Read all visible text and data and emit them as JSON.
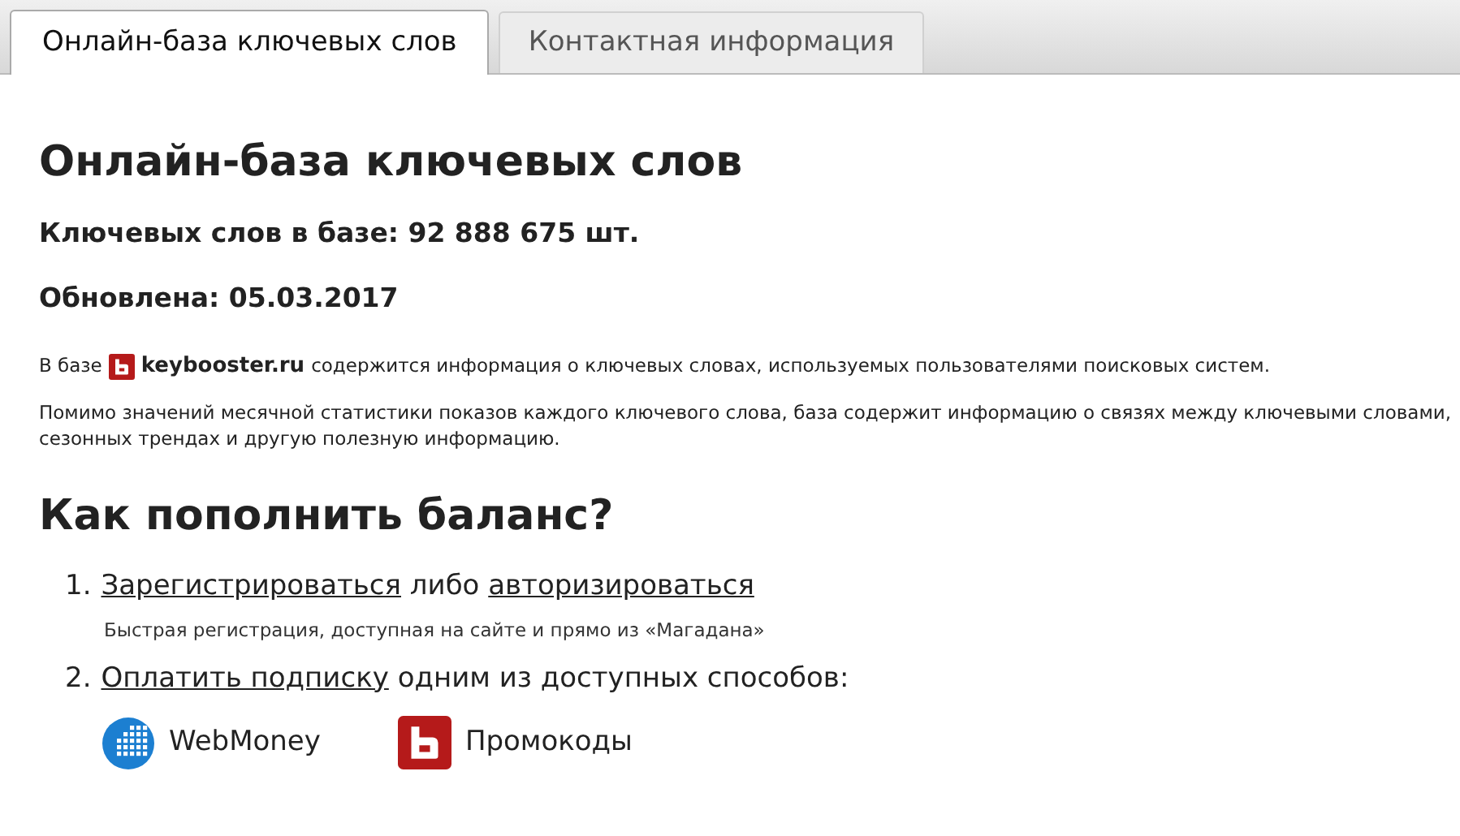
{
  "tabs": [
    {
      "label": "Онлайн-база ключевых слов",
      "selected": true
    },
    {
      "label": "Контактная информация",
      "selected": false
    }
  ],
  "title": "Онлайн-база ключевых слов",
  "stats": [
    "Ключевых слов в базе: 92 888 675 шт.",
    "Обновлена: 05.03.2017"
  ],
  "intro": {
    "before": "В базе",
    "brand": "keybooster.ru",
    "after": "содержится информация о ключевых словах, используемых пользователями поисковых систем."
  },
  "description": "Помимо значений месячной статистики показов каждого ключевого слова, база содержит информацию о связях между ключевыми словами, сезонных трендах и другую полезную информацию.",
  "section_title": "Как пополнить баланс?",
  "steps": [
    {
      "number": "1.",
      "parts": [
        {
          "kind": "link",
          "text": "Зарегистрироваться"
        },
        {
          "kind": "text",
          "text": "либо"
        },
        {
          "kind": "link",
          "text": "авторизироваться"
        }
      ],
      "note": "Быстрая регистрация, доступная на сайте и прямо из «Магадана»"
    },
    {
      "number": "2.",
      "parts": [
        {
          "kind": "link",
          "text": "Оплатить подписку"
        },
        {
          "kind": "text",
          "text": "одним из доступных способов:"
        }
      ]
    }
  ],
  "payment_methods": [
    {
      "kind": "webmoney",
      "label": "WebMoney"
    },
    {
      "kind": "promo",
      "label": "Промокоды"
    }
  ]
}
